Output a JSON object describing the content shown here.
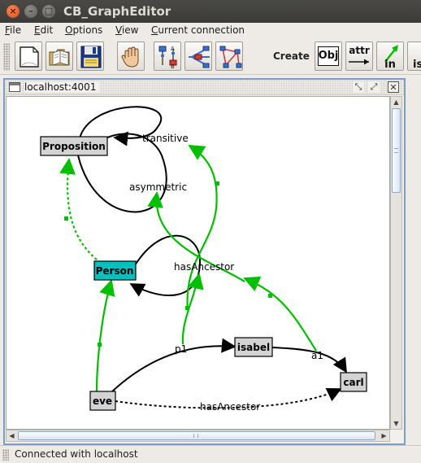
{
  "window": {
    "title": "CB_GraphEditor"
  },
  "menu": [
    {
      "label": "File",
      "mnemonic": "F",
      "rest": "ile"
    },
    {
      "label": "Edit",
      "mnemonic": "E",
      "rest": "dit"
    },
    {
      "label": "Options",
      "mnemonic": "O",
      "rest": "ptions"
    },
    {
      "label": "View",
      "mnemonic": "V",
      "rest": "iew"
    },
    {
      "label": "Current connection",
      "mnemonic": "C",
      "rest": "urrent connection"
    }
  ],
  "toolbar": {
    "buttons": [
      {
        "name": "new-icon"
      },
      {
        "name": "open-icon"
      },
      {
        "name": "save-icon"
      },
      {
        "name": "hand-icon"
      },
      {
        "name": "tree-layout-icon"
      },
      {
        "name": "graph-layout-icon"
      },
      {
        "name": "network-icon"
      }
    ],
    "create_label": "Create",
    "obj_label": "Obj",
    "attr_label": "attr",
    "in_label": "in",
    "isa_label": "is"
  },
  "internal_frame": {
    "title": "localhost:4001"
  },
  "graph": {
    "nodes": [
      {
        "id": "proposition",
        "label": "Proposition",
        "fill": "#d3d3d3"
      },
      {
        "id": "person",
        "label": "Person",
        "fill": "#00c0c0"
      },
      {
        "id": "isabel",
        "label": "isabel",
        "fill": "#d3d3d3"
      },
      {
        "id": "carl",
        "label": "carl",
        "fill": "#d3d3d3"
      },
      {
        "id": "eve",
        "label": "eve",
        "fill": "#d3d3d3"
      }
    ],
    "edge_labels": [
      {
        "id": "transitive",
        "label": "transitive"
      },
      {
        "id": "asymmetric",
        "label": "asymmetric"
      },
      {
        "id": "hasAncestor-person",
        "label": "hasAncestor"
      },
      {
        "id": "p1",
        "label": "p1"
      },
      {
        "id": "a1",
        "label": "a1"
      },
      {
        "id": "hasAncestor-eve",
        "label": "hasAncestor"
      }
    ],
    "colors": {
      "instance_edge": "#00c000",
      "attribute_edge": "#000000",
      "isa_edge": "#00c000"
    }
  },
  "status": {
    "text": "Connected with localhost"
  }
}
